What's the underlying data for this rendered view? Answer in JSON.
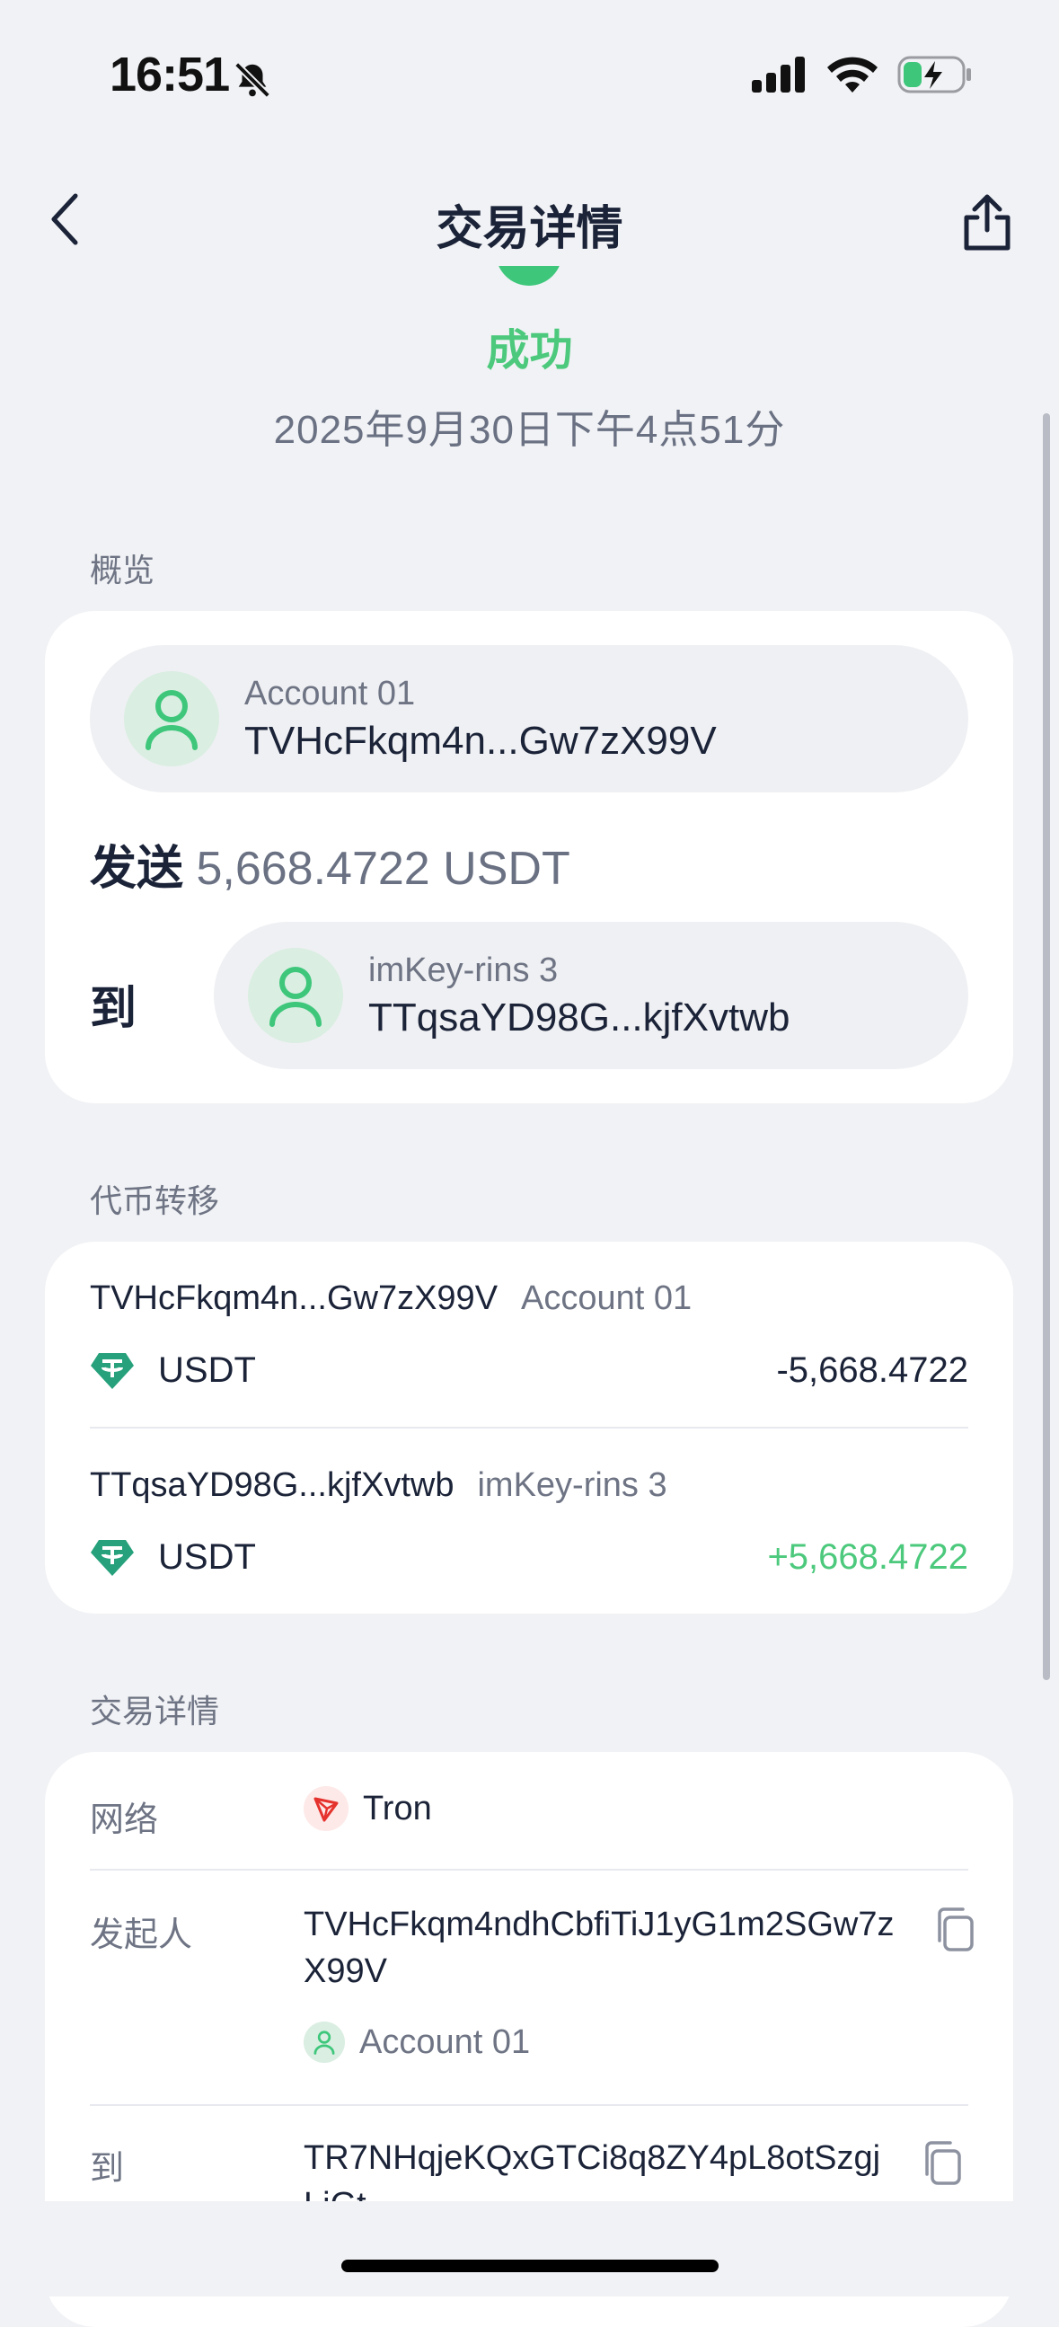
{
  "status_bar": {
    "time": "16:51",
    "icons": [
      "bell-slash-icon",
      "signal-icon",
      "wifi-icon",
      "battery-charging-icon"
    ]
  },
  "nav": {
    "title": "交易详情",
    "back_icon": "chevron-left-icon",
    "share_icon": "share-icon"
  },
  "status": {
    "text": "成功",
    "datetime": "2025年9月30日下午4点51分",
    "color": "#4cc97c"
  },
  "overview": {
    "section_label": "概览",
    "from": {
      "name": "Account 01",
      "address": "TVHcFkqm4n...Gw7zX99V"
    },
    "send_verb": "发送",
    "send_amount": "5,668.4722 USDT",
    "to_label": "到",
    "to": {
      "name": "imKey-rins 3",
      "address": "TTqsaYD98G...kjfXvtwb"
    }
  },
  "transfers": {
    "section_label": "代币转移",
    "rows": [
      {
        "address": "TVHcFkqm4n...Gw7zX99V",
        "name": "Account 01",
        "token": "USDT",
        "amount": "-5,668.4722"
      },
      {
        "address": "TTqsaYD98G...kjfXvtwb",
        "name": "imKey-rins 3",
        "token": "USDT",
        "amount": "+5,668.4722"
      }
    ]
  },
  "details": {
    "section_label": "交易详情",
    "network_label": "网络",
    "network_value": "Tron",
    "initiator_label": "发起人",
    "initiator_line1": "TVHcFkqm4ndhCbfiTiJ1yG1m2SGw7z",
    "initiator_line2": "X99V",
    "initiator_account": "Account 01",
    "to_label": "到",
    "to_line1": "TR7NHqjeKQxGTCi8q8ZY4pL8otSzgj",
    "to_line2": "LjGt"
  },
  "colors": {
    "accent_green": "#4cc97c",
    "tether_teal": "#26a17b",
    "tron_red": "#e5322d",
    "background": "#f1f2f5"
  }
}
